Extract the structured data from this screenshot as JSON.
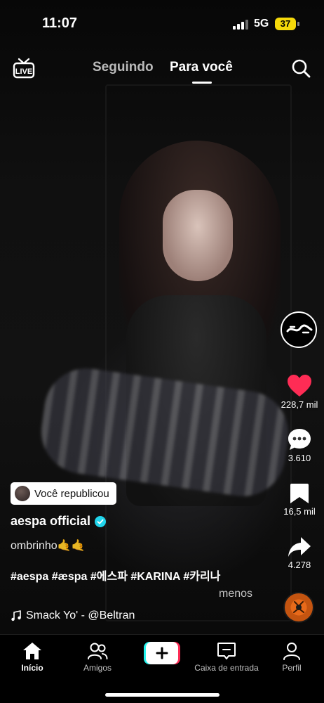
{
  "status_bar": {
    "time": "11:07",
    "network": "5G",
    "battery": "37"
  },
  "top_nav": {
    "live_label": "LIVE",
    "tabs": [
      {
        "label": "Seguindo"
      },
      {
        "label": "Para você"
      }
    ],
    "active_tab": "Para você"
  },
  "rail": {
    "likes": "228,7 mil",
    "comments": "3.610",
    "saves": "16,5 mil",
    "shares": "4.278",
    "like_color": "#fe2c55"
  },
  "caption": {
    "repost_label": "Você republicou",
    "username": "aespa official",
    "description": "ombrinho🤙🤙",
    "hashtags": "#aespa #æspa #에스파 #KARINA #카리나",
    "less_label": "menos",
    "sound": "Smack Yo' - @Beltran"
  },
  "bottom_nav": {
    "items": [
      {
        "label": "Início",
        "icon": "home-icon"
      },
      {
        "label": "Amigos",
        "icon": "friends-icon"
      },
      {
        "label": "",
        "icon": "plus-icon"
      },
      {
        "label": "Caixa de entrada",
        "icon": "inbox-icon"
      },
      {
        "label": "Perfil",
        "icon": "profile-icon"
      }
    ]
  },
  "colors": {
    "verified": "#20d5ec",
    "battery": "#f5d90a",
    "create_left": "#25f4ee",
    "create_right": "#fe2c55"
  }
}
